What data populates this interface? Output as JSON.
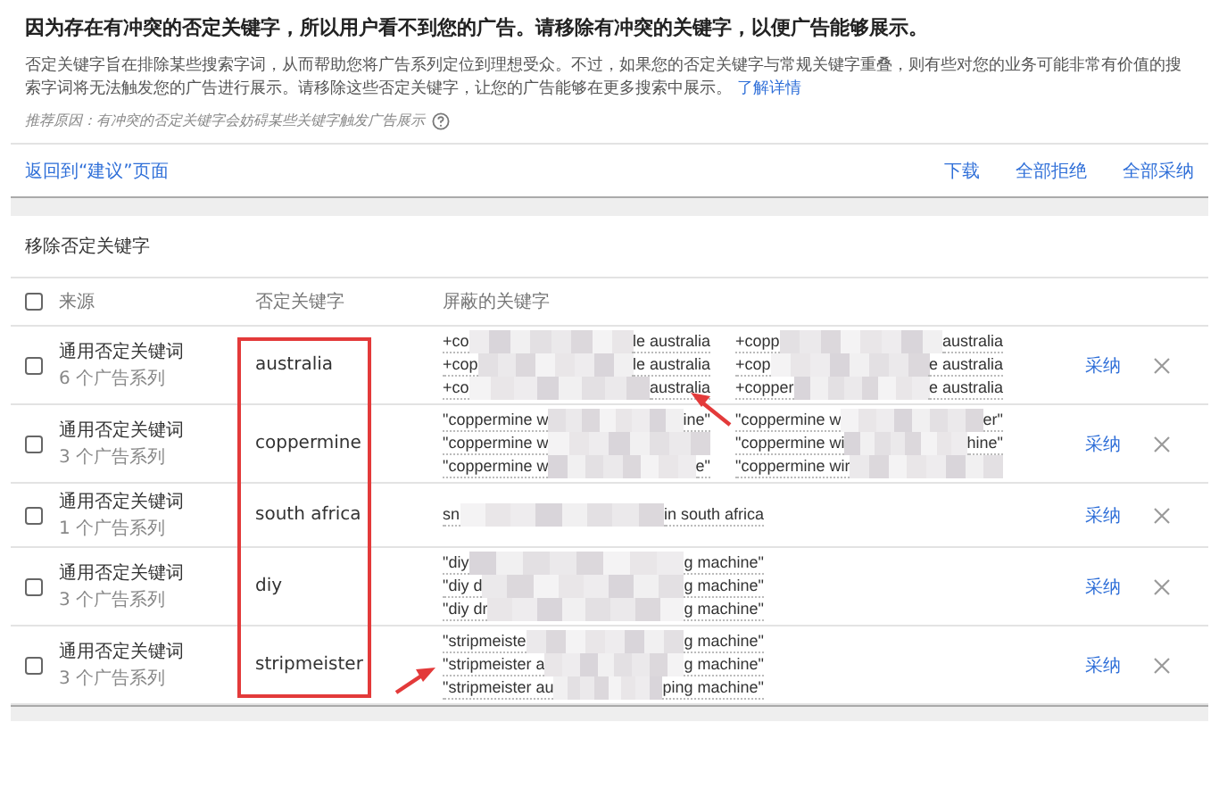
{
  "notice": {
    "title": "因为存在有冲突的否定关键字，所以用户看不到您的广告。请移除有冲突的关键字，以便广告能够展示。",
    "description": "否定关键字旨在排除某些搜索字词，从而帮助您将广告系列定位到理想受众。不过，如果您的否定关键字与常规关键字重叠，则有些对您的业务可能非常有价值的搜索字词将无法触发您的广告进行展示。请移除这些否定关键字，让您的广告能够在更多搜索中展示。",
    "learn_more": "了解详情",
    "reason": "推荐原因：有冲突的否定关键字会妨碍某些关键字触发广告展示"
  },
  "toolbar": {
    "back": "返回到“建议”页面",
    "actions": [
      "下载",
      "全部拒绝",
      "全部采纳"
    ]
  },
  "table": {
    "title": "移除否定关键字",
    "header_checked": false,
    "columns": [
      "来源",
      "否定关键字",
      "屏蔽的关键字"
    ],
    "rows": [
      {
        "checked": false,
        "source": "通用否定关键词",
        "campaigns": "6 个广告系列",
        "keyword": "australia",
        "blocked": [
          [
            {
              "start": "+co",
              "end": "le australia"
            },
            {
              "start": "+cop",
              "end": "le australia"
            },
            {
              "start": "+co",
              "end": "australia"
            }
          ],
          [
            {
              "start": "+copp",
              "end": "australia"
            },
            {
              "start": "+cop",
              "end": "e australia"
            },
            {
              "start": "+copper",
              "end": "e australia"
            }
          ]
        ],
        "accept": "采纳"
      },
      {
        "checked": false,
        "source": "通用否定关键词",
        "campaigns": "3 个广告系列",
        "keyword": "coppermine",
        "blocked": [
          [
            {
              "start": "\"coppermine w",
              "end": "ine\""
            },
            {
              "start": "\"coppermine w"
            },
            {
              "start": "\"coppermine w",
              "end": "e\""
            }
          ],
          [
            {
              "start": "\"coppermine w",
              "end": "er\""
            },
            {
              "start": "\"coppermine wi",
              "end": "hine\""
            },
            {
              "start": "\"coppermine wir"
            }
          ]
        ],
        "accept": "采纳"
      },
      {
        "checked": false,
        "source": "通用否定关键词",
        "campaigns": "1 个广告系列",
        "keyword": "south africa",
        "blocked": [
          [
            {
              "start": "sn",
              "end": "in south africa"
            }
          ]
        ],
        "accept": "采纳"
      },
      {
        "checked": false,
        "source": "通用否定关键词",
        "campaigns": "3 个广告系列",
        "keyword": "diy",
        "blocked": [
          [
            {
              "start": "\"diy",
              "end": "g machine\""
            },
            {
              "start": "\"diy d",
              "end": "g machine\""
            },
            {
              "start": "\"diy dr",
              "end": "g machine\""
            }
          ]
        ],
        "accept": "采纳"
      },
      {
        "checked": false,
        "source": "通用否定关键词",
        "campaigns": "3 个广告系列",
        "keyword": "stripmeister",
        "blocked": [
          [
            {
              "start": "\"stripmeiste",
              "end": "g machine\""
            },
            {
              "start": "\"stripmeister a",
              "end": "g machine\""
            },
            {
              "start": "\"stripmeister au",
              "end": "ping machine\""
            }
          ]
        ],
        "accept": "采纳"
      }
    ]
  }
}
